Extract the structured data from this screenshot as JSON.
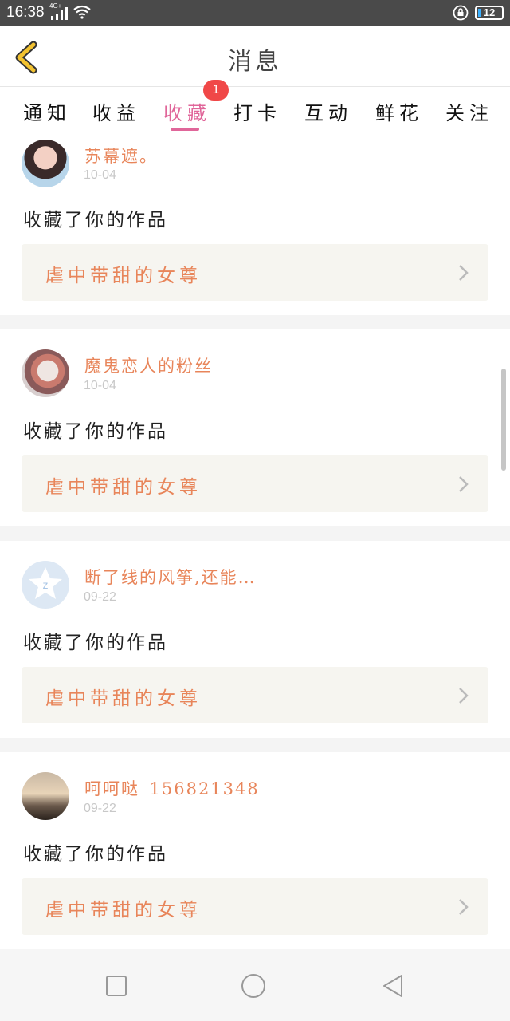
{
  "status_bar": {
    "time": "16:38",
    "network": "4G+",
    "battery": "12"
  },
  "header": {
    "title": "消息"
  },
  "tabs": [
    {
      "label": "通知",
      "active": false
    },
    {
      "label": "收益",
      "active": false
    },
    {
      "label": "收藏",
      "active": true,
      "badge": "1"
    },
    {
      "label": "打卡",
      "active": false
    },
    {
      "label": "互动",
      "active": false
    },
    {
      "label": "鲜花",
      "active": false
    },
    {
      "label": "关注",
      "active": false
    }
  ],
  "messages": [
    {
      "user": "苏幕遮。",
      "date": "10-04",
      "action": "收藏了你的作品",
      "work": "虐中带甜的女尊"
    },
    {
      "user": "魔鬼恋人的粉丝",
      "date": "10-04",
      "action": "收藏了你的作品",
      "work": "虐中带甜的女尊"
    },
    {
      "user": "断了线的风筝,还能…",
      "date": "09-22",
      "action": "收藏了你的作品",
      "work": "虐中带甜的女尊"
    },
    {
      "user": "呵呵哒_156821348",
      "date": "09-22",
      "action": "收藏了你的作品",
      "work": "虐中带甜的女尊"
    }
  ],
  "colors": {
    "accent": "#e0669a",
    "name": "#e8855a",
    "badge": "#f04848",
    "back": "#f2c230"
  },
  "icons": [
    "back-arrow-icon",
    "chevron-right-icon",
    "square-nav-icon",
    "circle-nav-icon",
    "triangle-back-nav-icon"
  ]
}
